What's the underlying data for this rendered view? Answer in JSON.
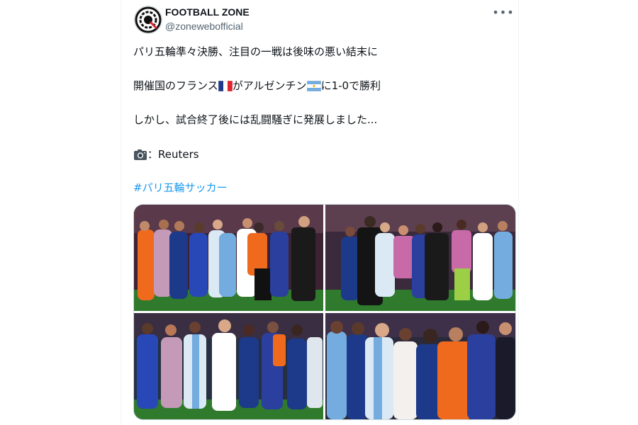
{
  "account": {
    "name": "FOOTBALL ZONE",
    "handle": "@zonewebofficial",
    "avatar_icon": "football-zone-logo-icon",
    "more_icon": "more-horizontal-icon"
  },
  "post": {
    "line1": "パリ五輪準々決勝、注目の一戦は後味の悪い結末に",
    "line2_part1": "開催国のフランス",
    "line2_part2": "がアルゼンチン",
    "line2_part3": "に1-0で勝利",
    "line3": "しかし、試合終了後には乱闘騒ぎに発展しました...",
    "credit_sep": "：",
    "credit": "Reuters",
    "hashtag": "#パリ五輪サッカー"
  },
  "icons": {
    "flag1": "france-flag-icon",
    "flag2": "argentina-flag-icon",
    "camera": "camera-icon"
  },
  "photos": [
    {
      "name": "photo-brawl-1",
      "description_icon": "photo"
    },
    {
      "name": "photo-brawl-2",
      "description_icon": "photo"
    },
    {
      "name": "photo-brawl-3",
      "description_icon": "photo"
    },
    {
      "name": "photo-brawl-4",
      "description_icon": "photo"
    }
  ],
  "colors": {
    "hashtag": "#1d9bf0",
    "text": "#0f1419",
    "secondary": "#536471",
    "france_blue": "#1d3a8a",
    "argentina_sky": "#74acdf",
    "referee_orange": "#f06a1e",
    "pitch_green": "#2f7a2c"
  }
}
